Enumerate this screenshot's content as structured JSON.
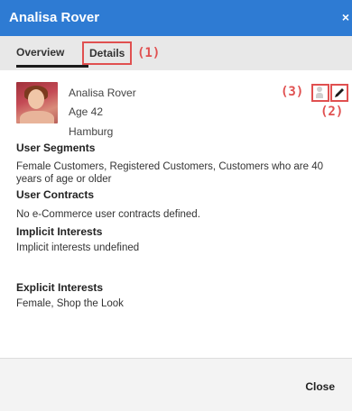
{
  "dialog": {
    "title": "Analisa Rover",
    "close_glyph": "×"
  },
  "tabs": [
    {
      "label": "Overview",
      "active": true
    },
    {
      "label": "Details",
      "active": false
    }
  ],
  "markers": {
    "m1": "(1)",
    "m2": "(2)",
    "m3": "(3)"
  },
  "profile": {
    "name": "Analisa Rover",
    "age": "Age 42",
    "city": "Hamburg",
    "avatar_icon": "profile-photo"
  },
  "actions": {
    "edit_icon": "pencil-icon",
    "persona_icon": "person-icon"
  },
  "sections": {
    "segments_title": "User Segments",
    "segments_text": "Female Customers, Registered Customers, Customers who are 40 years of age or older",
    "contracts_title": "User Contracts",
    "contracts_text": "No e-Commerce user contracts defined.",
    "implicit_title": "Implicit Interests",
    "implicit_text": "Implicit interests undefined",
    "explicit_title": "Explicit Interests",
    "explicit_text": "Female, Shop the Look"
  },
  "footer": {
    "close_label": "Close"
  },
  "colors": {
    "titlebar": "#2e7bd3",
    "highlight": "#e05050",
    "tabbar": "#e8e8e8",
    "footer": "#f3f3f3"
  }
}
